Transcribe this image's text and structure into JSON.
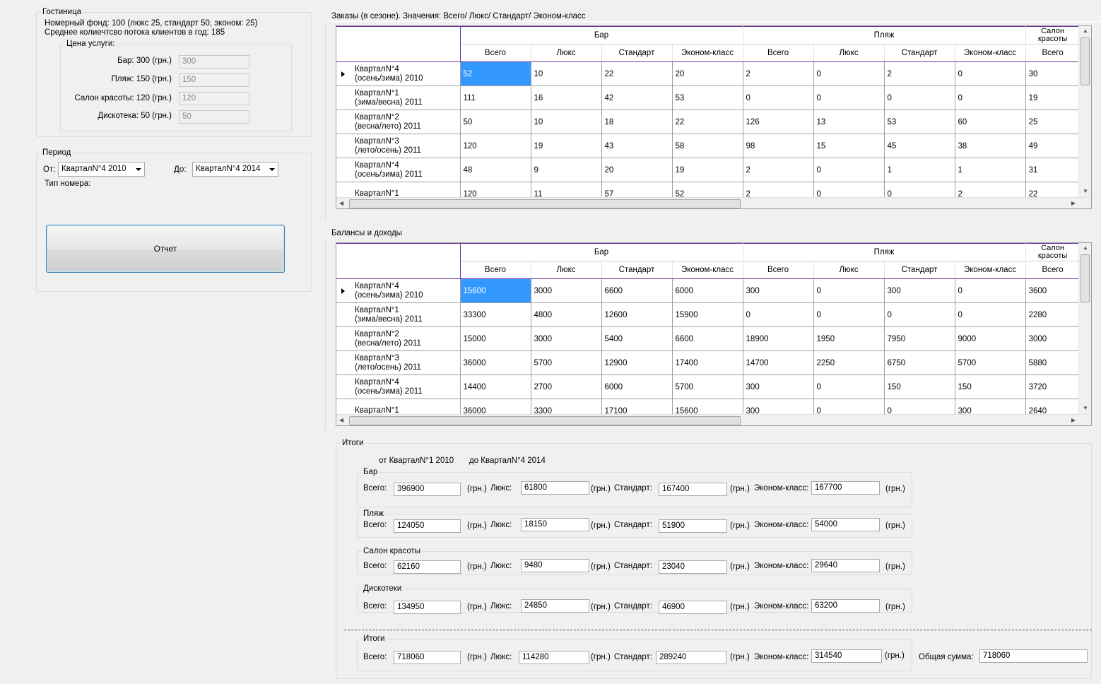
{
  "hotel": {
    "legend": "Гостиница",
    "rooms_line": "Номерный фонд: 100 (люкс 25, стандарт 50, эконом: 25)",
    "flow_line": "Среднее колиечтсво  потока клиентов в год: 185",
    "prices_legend": "Цена услуги:",
    "prices": [
      {
        "label": "Бар: 300 (грн.)",
        "value": "300"
      },
      {
        "label": "Пляж: 150 (грн.)",
        "value": "150"
      },
      {
        "label": "Салон красоты: 120 (грн.)",
        "value": "120"
      },
      {
        "label": "Дискотека: 50 (грн.)",
        "value": "50"
      }
    ]
  },
  "period": {
    "legend": "Период",
    "from_label": "От:",
    "from_value": "КварталN°4 2010",
    "to_label": "До:",
    "to_value": "КварталN°4 2014",
    "room_type_label": "Тип номера:",
    "report_button": "Отчет"
  },
  "orders": {
    "title": "Заказы (в сезоне). Значения: Всего/ Люкс/ Стандарт/ Эконом-класс",
    "group_headers": [
      "Бар",
      "Пляж",
      "Салон\nкрасоты"
    ],
    "sub_headers": [
      "Всего",
      "Люкс",
      "Стандарт",
      "Эконом-класс",
      "Всего",
      "Люкс",
      "Стандарт",
      "Эконом-класс",
      "Всего"
    ],
    "rows": [
      {
        "label": [
          "КварталN°4",
          "(осень/зима) 2010"
        ],
        "values": [
          "52",
          "10",
          "22",
          "20",
          "2",
          "0",
          "2",
          "0",
          "30"
        ]
      },
      {
        "label": [
          "КварталN°1",
          "(зима/весна) 2011"
        ],
        "values": [
          "111",
          "16",
          "42",
          "53",
          "0",
          "0",
          "0",
          "0",
          "19"
        ]
      },
      {
        "label": [
          "КварталN°2",
          "(весна/лето) 2011"
        ],
        "values": [
          "50",
          "10",
          "18",
          "22",
          "126",
          "13",
          "53",
          "60",
          "25"
        ]
      },
      {
        "label": [
          "КварталN°3",
          "(лето/осень) 2011"
        ],
        "values": [
          "120",
          "19",
          "43",
          "58",
          "98",
          "15",
          "45",
          "38",
          "49"
        ]
      },
      {
        "label": [
          "КварталN°4",
          "(осень/зима) 2011"
        ],
        "values": [
          "48",
          "9",
          "20",
          "19",
          "2",
          "0",
          "1",
          "1",
          "31"
        ]
      },
      {
        "label": [
          "КварталN°1",
          ""
        ],
        "values": [
          "120",
          "11",
          "57",
          "52",
          "2",
          "0",
          "0",
          "2",
          "22"
        ]
      }
    ]
  },
  "balances": {
    "title": "Балансы и доходы",
    "group_headers": [
      "Бар",
      "Пляж",
      "Салон\nкрасоты"
    ],
    "sub_headers": [
      "Всего",
      "Люкс",
      "Стандарт",
      "Эконом-класс",
      "Всего",
      "Люкс",
      "Стандарт",
      "Эконом-класс",
      "Всего"
    ],
    "rows": [
      {
        "label": [
          "КварталN°4",
          "(осень/зима) 2010"
        ],
        "values": [
          "15600",
          "3000",
          "6600",
          "6000",
          "300",
          "0",
          "300",
          "0",
          "3600"
        ]
      },
      {
        "label": [
          "КварталN°1",
          "(зима/весна) 2011"
        ],
        "values": [
          "33300",
          "4800",
          "12600",
          "15900",
          "0",
          "0",
          "0",
          "0",
          "2280"
        ]
      },
      {
        "label": [
          "КварталN°2",
          "(весна/лето) 2011"
        ],
        "values": [
          "15000",
          "3000",
          "5400",
          "6600",
          "18900",
          "1950",
          "7950",
          "9000",
          "3000"
        ]
      },
      {
        "label": [
          "КварталN°3",
          "(лето/осень) 2011"
        ],
        "values": [
          "36000",
          "5700",
          "12900",
          "17400",
          "14700",
          "2250",
          "6750",
          "5700",
          "5880"
        ]
      },
      {
        "label": [
          "КварталN°4",
          "(осень/зима) 2011"
        ],
        "values": [
          "14400",
          "2700",
          "6000",
          "5700",
          "300",
          "0",
          "150",
          "150",
          "3720"
        ]
      },
      {
        "label": [
          "КварталN°1",
          ""
        ],
        "values": [
          "36000",
          "3300",
          "17100",
          "15600",
          "300",
          "0",
          "0",
          "300",
          "2640"
        ]
      }
    ]
  },
  "totals": {
    "legend": "Итоги",
    "range_from": "от КварталN°1 2010",
    "range_to": "до КварталN°4 2014",
    "labels": {
      "total": "Всего:",
      "lux": "Люкс:",
      "standard": "Стандарт:",
      "economy": "Эконом-класс:",
      "currency": "(грн.)",
      "grand_total": "Общая сумма:"
    },
    "groups": [
      {
        "name": "Бар",
        "total": "396900",
        "lux": "61800",
        "standard": "167400",
        "economy": "167700"
      },
      {
        "name": "Пляж",
        "total": "124050",
        "lux": "18150",
        "standard": "51900",
        "economy": "54000"
      },
      {
        "name": "Салон красоты",
        "total": "62160",
        "lux": "9480",
        "standard": "23040",
        "economy": "29640"
      },
      {
        "name": "Дискотеки",
        "total": "134950",
        "lux": "24850",
        "standard": "46900",
        "economy": "63200"
      }
    ],
    "summary": {
      "name": "Итоги",
      "total": "718060",
      "lux": "114280",
      "standard": "289240",
      "economy": "314540",
      "grand_total": "718060"
    }
  }
}
